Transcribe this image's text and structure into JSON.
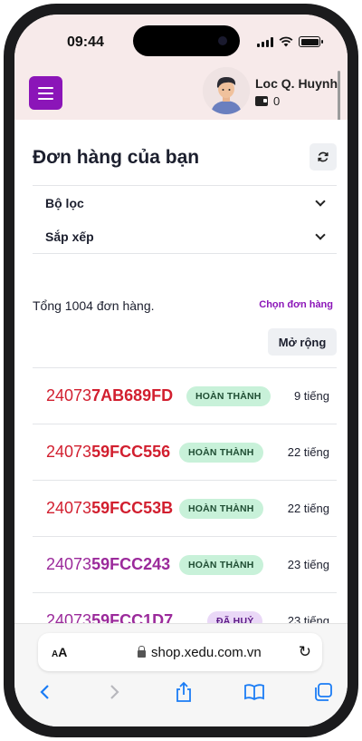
{
  "status_bar": {
    "time": "09:44"
  },
  "header": {
    "user_name": "Loc Q. Huynh",
    "wallet_balance": "0",
    "accent_color": "#8b15b8"
  },
  "page": {
    "title": "Đơn hàng của bạn",
    "filters": [
      {
        "label": "Bộ lọc"
      },
      {
        "label": "Sắp xếp"
      }
    ],
    "total_text": "Tổng 1004 đơn hàng.",
    "select_orders_label": "Chọn đơn hàng",
    "expand_label": "Mở rộng"
  },
  "orders": [
    {
      "id_prefix": "24073",
      "id_suffix": "7AB689FD",
      "status": "HOÀN THÀNH",
      "status_type": "done",
      "age": "9 tiếng",
      "color": "#d21f2f"
    },
    {
      "id_prefix": "24073",
      "id_suffix": "59FCC556",
      "status": "HOÀN THÀNH",
      "status_type": "done",
      "age": "22 tiếng",
      "color": "#d21f2f"
    },
    {
      "id_prefix": "24073",
      "id_suffix": "59FCC53B",
      "status": "HOÀN THÀNH",
      "status_type": "done",
      "age": "22 tiếng",
      "color": "#d21f2f"
    },
    {
      "id_prefix": "24073",
      "id_suffix": "59FCC243",
      "status": "HOÀN THÀNH",
      "status_type": "done",
      "age": "23 tiếng",
      "color": "#9b2a9b"
    },
    {
      "id_prefix": "24073",
      "id_suffix": "59FCC1D7",
      "status": "ĐÃ HUỶ",
      "status_type": "cancel",
      "age": "23 tiếng",
      "color": "#9b2a9b"
    }
  ],
  "browser": {
    "text_size_label": "AA",
    "url": "shop.xedu.com.vn",
    "nav": [
      "back-icon",
      "forward-icon",
      "share-icon",
      "bookmarks-icon",
      "tabs-icon"
    ]
  }
}
